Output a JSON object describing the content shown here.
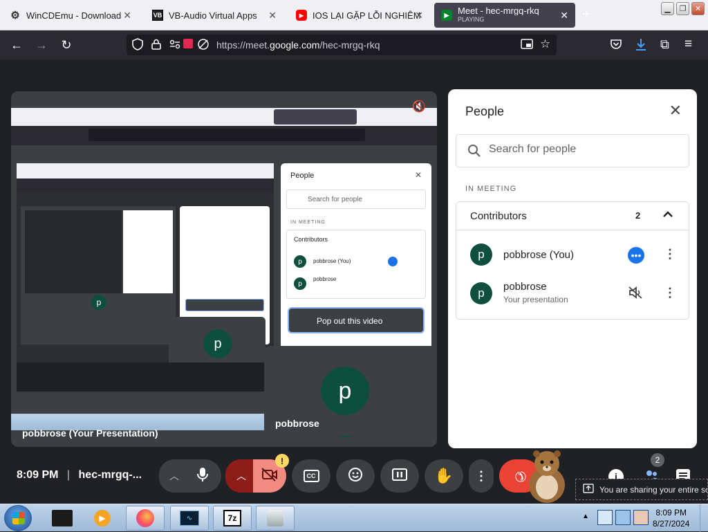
{
  "browser": {
    "tabs": [
      {
        "title": "WinCDEmu - Download",
        "favicon": "gear-icon"
      },
      {
        "title": "VB-Audio Virtual Apps",
        "favicon": "vb-icon"
      },
      {
        "title": "IOS LẠI GẶP LỖI NGHIÊM TR",
        "favicon": "youtube-icon"
      },
      {
        "title": "Meet - hec-mrgq-rkq",
        "subtitle": "PLAYING",
        "favicon": "meet-icon"
      }
    ],
    "url_prefix": "https://meet.",
    "url_host": "google.com",
    "url_path": "/hec-mrgq-rkq"
  },
  "meet": {
    "tile_label": "pobbrose (Your Presentation)",
    "self_tile_name": "pobbrose",
    "clock": "8:09 PM",
    "separator": "|",
    "meeting_code": "hec-mrgq-...",
    "people_badge": "2",
    "alert_badge": "!",
    "share_text": "You are sharing your entire screen"
  },
  "people_panel": {
    "title": "People",
    "search_placeholder": "Search for people",
    "section": "IN MEETING",
    "group": "Contributors",
    "group_count": "2",
    "participants": [
      {
        "initial": "p",
        "name": "pobbrose (You)",
        "sub": ""
      },
      {
        "initial": "p",
        "name": "pobbrose",
        "sub": "Your presentation"
      }
    ],
    "popout_label": "Pop out this video"
  },
  "taskbar": {
    "time": "8:09 PM",
    "date": "8/27/2024",
    "apps": [
      "media-icon",
      "firefox-icon",
      "monitor-icon",
      "7zip-icon",
      "installer-icon"
    ]
  },
  "colors": {
    "accent": "#1a73e8",
    "avatar": "#0d4f3c",
    "end_call": "#ea4335",
    "cam_off": "#f28b82"
  }
}
